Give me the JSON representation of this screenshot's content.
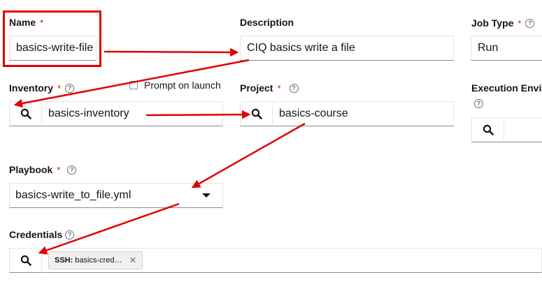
{
  "name": {
    "label": "Name",
    "required": "*",
    "value": "basics-write-file"
  },
  "description": {
    "label": "Description",
    "value": "CIQ basics write a file"
  },
  "job_type": {
    "label": "Job Type",
    "required": "*",
    "value": "Run"
  },
  "inventory": {
    "label": "Inventory",
    "required": "*",
    "value": "basics-inventory",
    "prompt_on_launch": "Prompt on launch"
  },
  "project": {
    "label": "Project",
    "required": "*",
    "value": "basics-course"
  },
  "execution_environment": {
    "label": "Execution Envi"
  },
  "playbook": {
    "label": "Playbook",
    "required": "*",
    "value": "basics-write_to_file.yml"
  },
  "credentials": {
    "label": "Credentials",
    "chip_type": "SSH:",
    "chip_value": "basics-cred…",
    "chip_remove": "✕"
  },
  "icons": {
    "search": "search-icon",
    "help": "help-icon",
    "caret": "caret-down-icon",
    "close": "close-icon"
  },
  "colors": {
    "annotation": "#e00000",
    "required": "#c9190b"
  }
}
